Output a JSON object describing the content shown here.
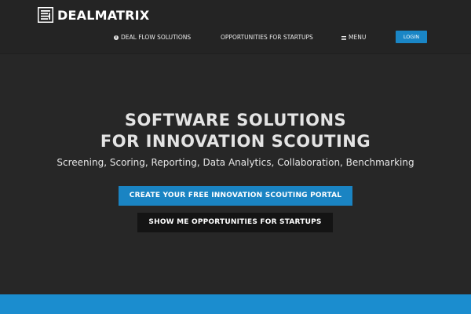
{
  "header": {
    "logo_text": "DEALMATRIX",
    "nav": {
      "deal_flow": "DEAL FLOW SOLUTIONS",
      "opportunities": "OPPORTUNITIES FOR STARTUPS",
      "menu": "MENU"
    },
    "login_label": "LOGIN"
  },
  "hero": {
    "title_line1": "SOFTWARE SOLUTIONS",
    "title_line2": "FOR INNOVATION SCOUTING",
    "subtitle": "Screening, Scoring, Reporting, Data Analytics, Collaboration, Benchmarking",
    "cta_primary": "CREATE YOUR FREE INNOVATION SCOUTING PORTAL",
    "cta_secondary": "SHOW ME OPPORTUNITIES FOR STARTUPS"
  },
  "colors": {
    "background": "#272727",
    "accent": "#1a86c6",
    "dark_button": "#141414"
  },
  "icons": {
    "logo": "logo-mark-icon",
    "deal_flow": "info-circle-icon",
    "menu": "hamburger-icon"
  }
}
